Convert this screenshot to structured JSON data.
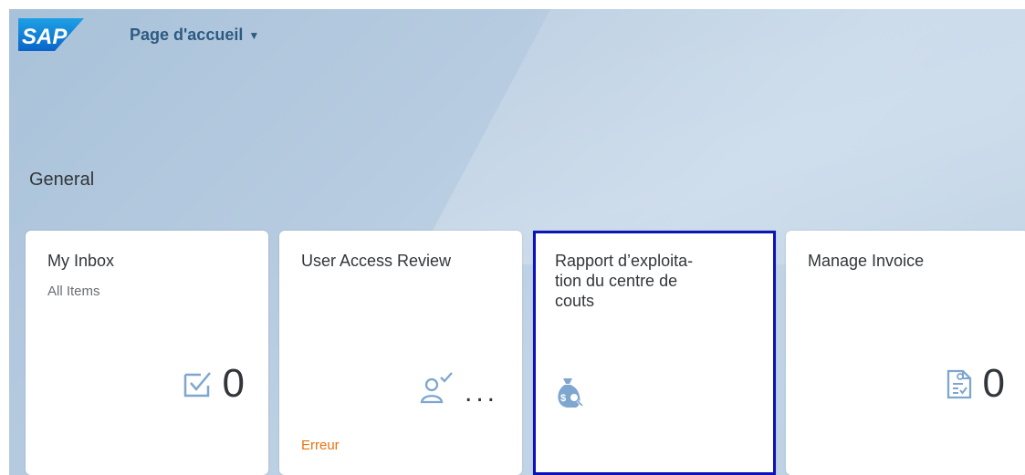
{
  "header": {
    "logo_text": "SAP",
    "title": "Page d'accueil",
    "caret": "▼"
  },
  "group": {
    "title": "General"
  },
  "tiles": [
    {
      "title": "My Inbox",
      "subtitle": "All Items",
      "icon": "inbox-check-icon",
      "value": "0"
    },
    {
      "title": "User Access Review",
      "icon": "user-check-icon",
      "value": "...",
      "footer": "Erreur"
    },
    {
      "title": "Rapport d’exploita-\ntion du centre de\ncouts",
      "icon": "money-bag-search-icon",
      "selected": true
    },
    {
      "title": "Manage Invoice",
      "icon": "invoice-document-icon",
      "value": "0"
    }
  ],
  "colors": {
    "brand_blue": "#0a6ed1",
    "selection_border": "#0a14b8",
    "error_text": "#e9730c",
    "icon_blue": "#7ea6cf"
  }
}
